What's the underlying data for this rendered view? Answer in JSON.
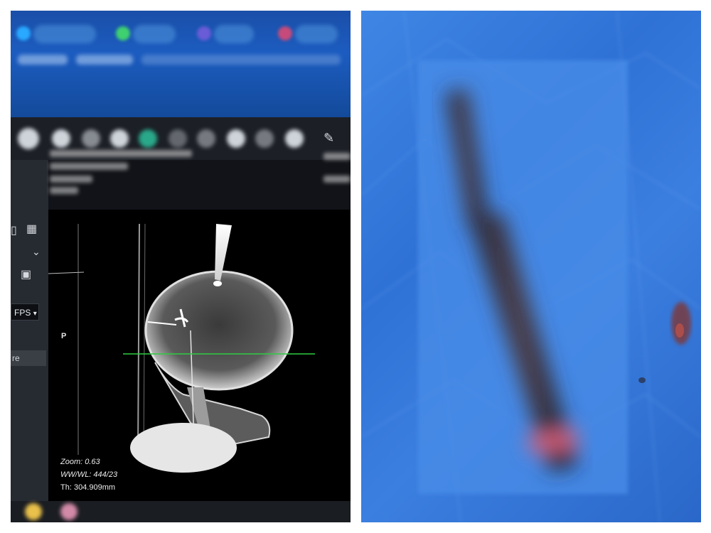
{
  "viewer": {
    "fps_label": "FPS",
    "field_partial_text": "re",
    "orientation_label": "P",
    "overlay": {
      "zoom": "Zoom: 0.63",
      "ww_wl": "WW/WL: 444/23",
      "thickness": "Th: 304.909mm"
    }
  },
  "colors": {
    "title_bar": "#1c5cc0",
    "viewer_background": "#111318",
    "reference_line": "#2ecc40",
    "drape": "#2f72d6"
  },
  "icons": [
    "grid-icon",
    "layout-icon",
    "chevron-down-icon",
    "image-icon",
    "edit-icon"
  ]
}
